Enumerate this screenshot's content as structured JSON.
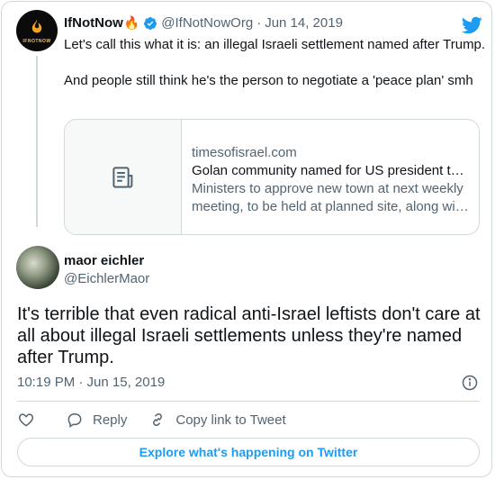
{
  "quoted_tweet": {
    "author_name": "IfNotNow",
    "name_emoji": "🔥",
    "handle": "@IfNotNowOrg",
    "separator": "·",
    "date": "Jun 14, 2019",
    "text": "Let's call this what it is: an illegal Israeli settlement named after Trump.\n\nAnd people still think he's the person to negotiate a 'peace plan' smh",
    "avatar_icon": "flame-logo-icon",
    "avatar_text": "IFNOTNOW"
  },
  "link_card": {
    "domain": "timesofisrael.com",
    "title": "Golan community named for US president t…",
    "description_line1": "Ministers to approve new town at next weekly",
    "description_line2": "meeting, to be held at planned site, along wi…",
    "icon": "document-icon"
  },
  "main_tweet": {
    "author_name": "maor eichler",
    "handle": "@EichlerMaor",
    "text": "It's terrible that even radical anti-Israel leftists don't care at all about illegal Israeli settlements unless they're named after Trump.",
    "timestamp": "10:19 PM · Jun 15, 2019"
  },
  "actions": {
    "reply_label": "Reply",
    "copy_link_label": "Copy link to Tweet"
  },
  "explore_label": "Explore what's happening on Twitter",
  "colors": {
    "accent": "#1d9bf0",
    "muted": "#536471",
    "border": "#cfd9de"
  }
}
